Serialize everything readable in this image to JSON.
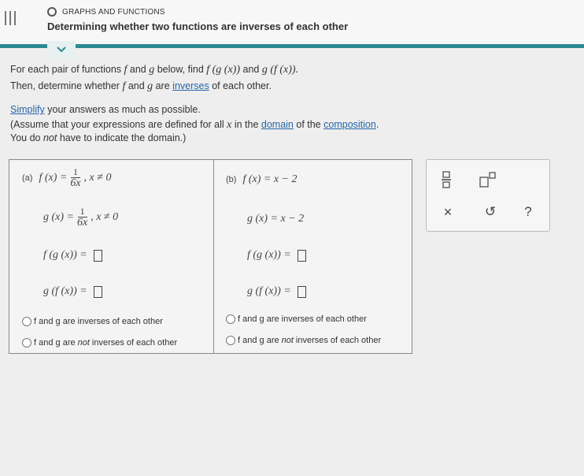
{
  "header": {
    "topic": "GRAPHS AND FUNCTIONS",
    "title": "Determining whether two functions are inverses of each other",
    "menu_icon": "hamburger-icon",
    "accent_color": "#2c8a93"
  },
  "instructions": {
    "line1_prefix": "For each pair of functions ",
    "f": "f",
    "and": " and ",
    "g": "g",
    "line1_mid": " below, find ",
    "fgx": "f (g (x))",
    "gfx": "g (f (x)).",
    "line2_prefix": "Then, determine whether ",
    "line2_mid": " are ",
    "inverses_link": "inverses",
    "line2_suffix": " of each other.",
    "simplify_link": "Simplify",
    "simplify_suffix": " your answers as much as possible.",
    "assume_prefix": "(Assume that your expressions are defined for all ",
    "x": "x",
    "assume_mid": " in the ",
    "domain_link": "domain",
    "assume_mid2": " of the ",
    "composition_link": "composition",
    "assume_suffix": ".",
    "note_prefix": "You do ",
    "note_not": "not",
    "note_suffix": " have to indicate the domain.)"
  },
  "part_a": {
    "label": "(a)",
    "f_lhs": "f (x) =",
    "f_num": "1",
    "f_den": "6x",
    "f_cond": ", x ≠ 0",
    "g_lhs": "g (x) =",
    "g_num": "1",
    "g_den": "6x",
    "g_cond": ", x ≠ 0",
    "fg": "f (g (x)) =",
    "gf": "g (f (x)) =",
    "opt_inv": "f and g are inverses of each other",
    "opt_not_inv_prefix": "f and g are ",
    "opt_not_word": "not",
    "opt_not_inv_suffix": " inverses of each other"
  },
  "part_b": {
    "label": "(b)",
    "f_def": "f (x) = x − 2",
    "g_def": "g (x) = x − 2",
    "fg": "f (g (x)) =",
    "gf": "g (f (x)) =",
    "opt_inv": "f and g are inverses of each other",
    "opt_not_inv_prefix": "f and g are ",
    "opt_not_word": "not",
    "opt_not_inv_suffix": " inverses of each other"
  },
  "tools": {
    "fraction": "fraction-icon",
    "superscript": "superscript-icon",
    "clear": "×",
    "undo": "↺",
    "help": "?"
  }
}
